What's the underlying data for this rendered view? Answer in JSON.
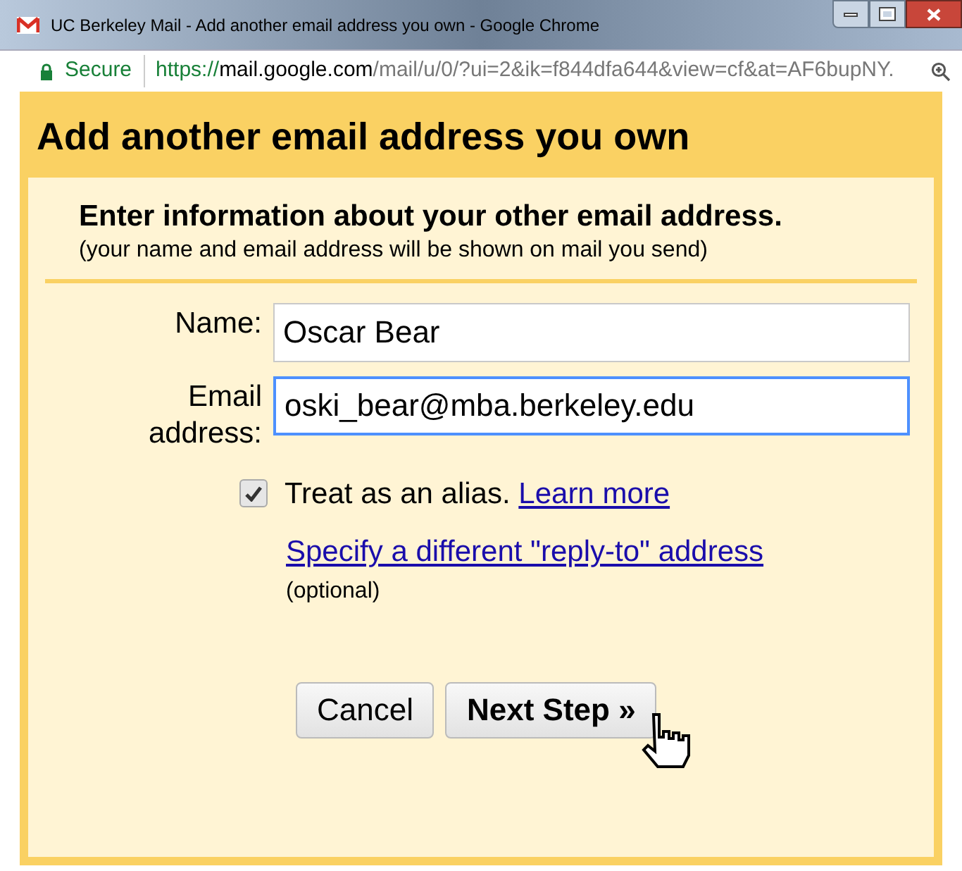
{
  "window": {
    "title": "UC Berkeley Mail - Add another email address you own - Google Chrome"
  },
  "address_bar": {
    "security": "Secure",
    "scheme": "https://",
    "host": "mail.google.com",
    "path": "/mail/u/0/?ui=2&ik=f844dfa644&view=cf&at=AF6bupNY."
  },
  "dialog": {
    "title": "Add another email address you own",
    "heading": "Enter information about your other email address.",
    "subheading": "(your name and email address will be shown on mail you send)",
    "fields": [
      {
        "label": "Name:",
        "value": "Oscar Bear",
        "focused": false
      },
      {
        "label": "Email address:",
        "value": "oski_bear@mba.berkeley.edu",
        "focused": true
      }
    ],
    "alias": {
      "label": "Treat as an alias.",
      "checked": true,
      "link": "Learn more"
    },
    "reply_to": {
      "link": "Specify a different \"reply-to\" address",
      "note": "(optional)"
    },
    "buttons": [
      "Cancel",
      "Next Step »"
    ]
  }
}
